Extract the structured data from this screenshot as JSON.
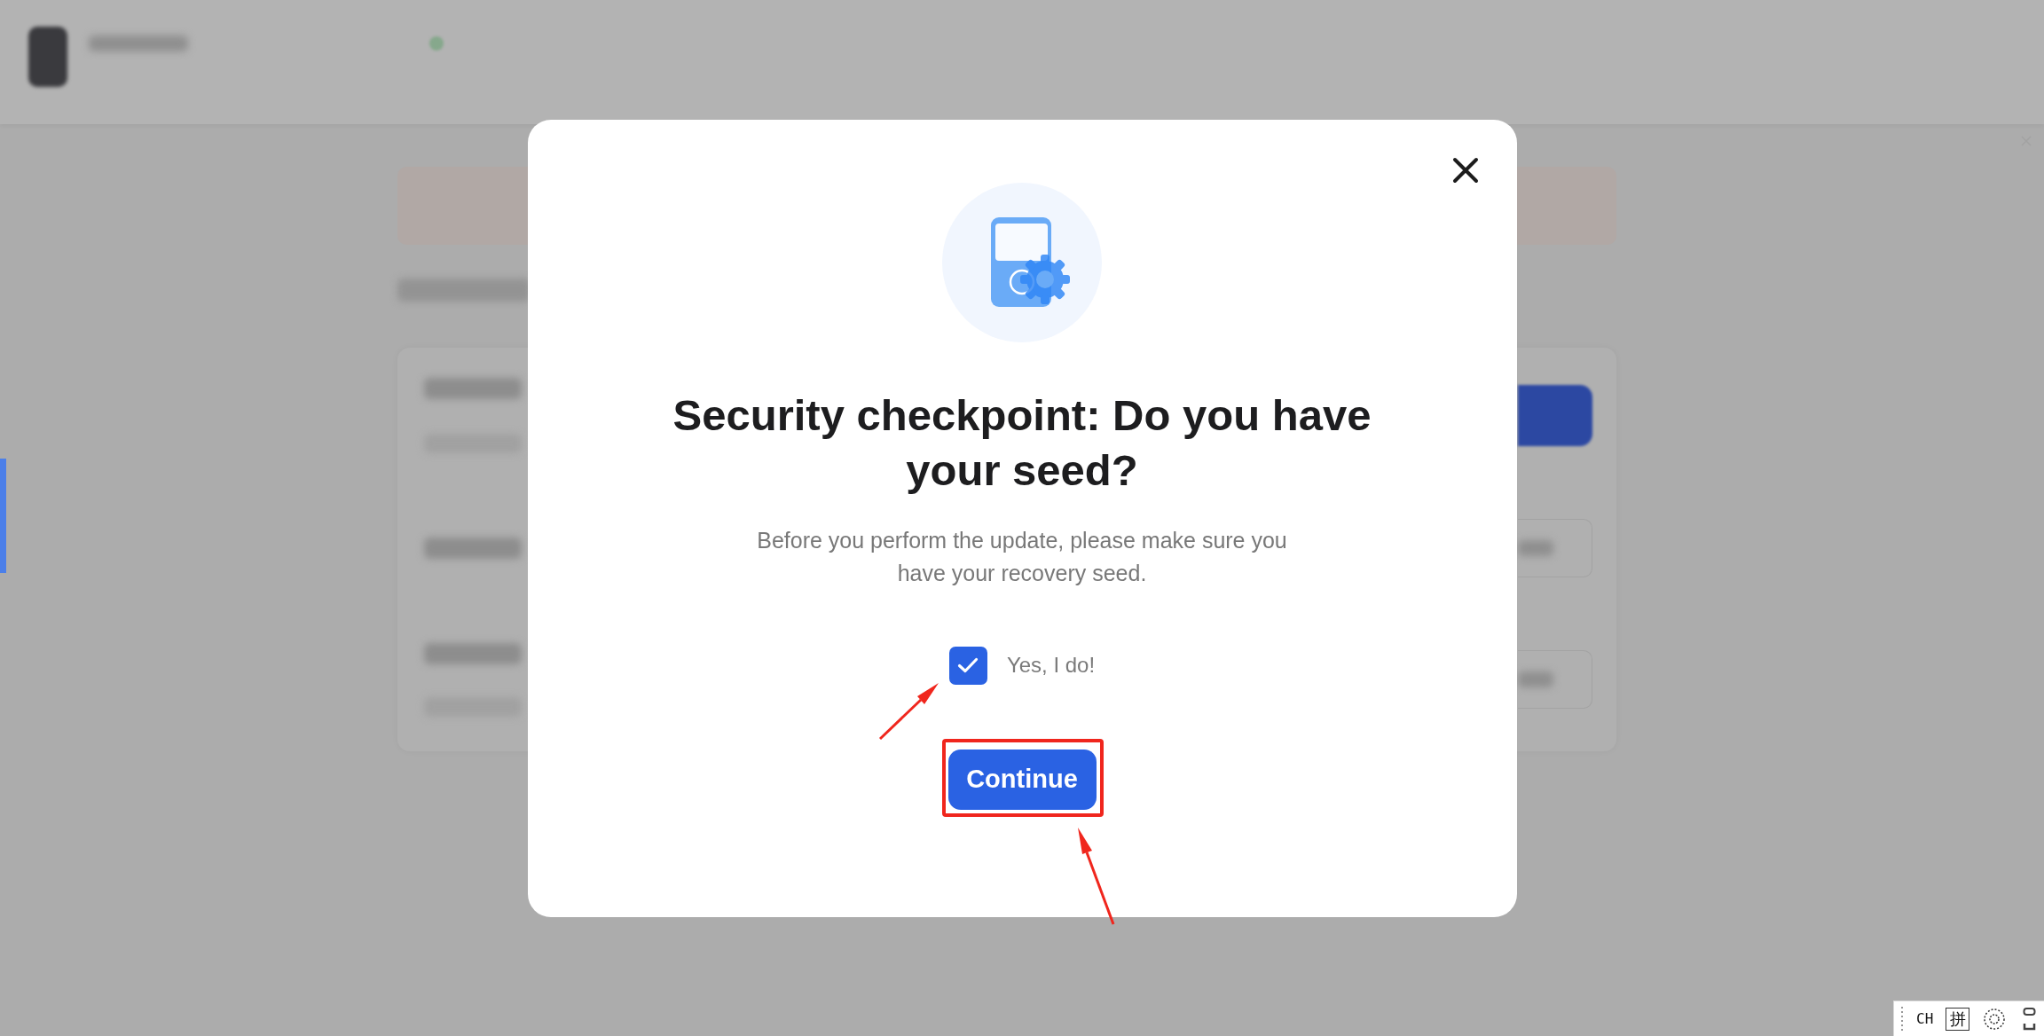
{
  "dialog": {
    "title": "Security checkpoint: Do you have your seed?",
    "description": "Before you perform the update, please make sure you have your recovery seed.",
    "checkbox": {
      "label": "Yes, I do!",
      "checked": true
    },
    "button": {
      "label": "Continue"
    }
  },
  "ime_bar": {
    "language": "CH",
    "input_mode": "拼"
  }
}
